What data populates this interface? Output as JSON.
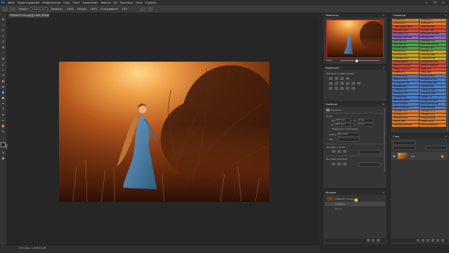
{
  "app": {
    "logo": "Ps",
    "menu": [
      "Файл",
      "Редактирование",
      "Изображение",
      "Слои",
      "Текст",
      "Выделение",
      "Фильтр",
      "3D",
      "Просмотр",
      "Окно",
      "Справка"
    ],
    "window_controls": [
      "—",
      "❐",
      "✕"
    ]
  },
  "options": {
    "items": [
      "Режим:",
      "Нормальный",
      "Непрозр.:",
      "100%",
      "Нажим:",
      "100%",
      "Сглаживание:",
      "10%"
    ]
  },
  "document": {
    "tab_label": "*FRENCH2 v01.jpg @ 100% (RGB/8) ×",
    "status": "100%   Док: 3,52M/3,52M"
  },
  "navigator": {
    "title": "Навигатор",
    "zoom": "100%"
  },
  "adjustments": {
    "title": "Коррекция",
    "subtitle": "Добавить корректировку"
  },
  "properties": {
    "title": "Свойства",
    "doc_label": "Документ",
    "section_canvas": "Холст",
    "w_label": "Ш",
    "h_label": "В",
    "w_value": "3000 пикс.",
    "h_value": "2000 пикс.",
    "x_label": "X",
    "y_label": "Y",
    "x_value": "0 пикс.",
    "y_value": "0 пикс.",
    "resolution": "Разрешение: 72 пикс/дюйм",
    "mode_label": "Режим",
    "mode_value": "Цвета RGB",
    "fill_label": "Фон",
    "section_guides": "Линейки и сетка",
    "section_quick": "Быстрые действия"
  },
  "history": {
    "title": "История",
    "items": [
      "FRENCH2 v01.jpg",
      "Открыть",
      "Кисть"
    ]
  },
  "actions": {
    "title": "Операции",
    "rows": [
      [
        "КОНТРАСТ 1",
        "КОНТРАСТ 2",
        "#e07a2a",
        "#e07a2a"
      ],
      [
        "КОНТРАСТ 3",
        "КОНТРАСТ 4",
        "#e07a2a",
        "#e07a2a"
      ],
      [
        "С ВИГНЕТКОЙ ЯРКО",
        "С ВИГНЕТКОЙ",
        "#d24a3a",
        "#d24a3a"
      ],
      [
        "ТЁПЛЫЙ ЗАКАТ",
        "ТЁПЛЫЙ СВЕТ",
        "#d24a3a",
        "#d24a3a"
      ],
      [
        "ВЕЧЕРНИЙ ТОН",
        "ВЕЧЕРНИЙ МЯГКИЙ",
        "#9c5bbf",
        "#9c5bbf"
      ],
      [
        "МЯГКИЙ КОНТРАСТ",
        "МЯГКИЙ ТОН",
        "#9c5bbf",
        "#9c5bbf"
      ],
      [
        "ЗЕЛЁНЫЙ ЛЕС",
        "ЗЕЛЁНЫЙ ТОН",
        "#4fa04a",
        "#4fa04a"
      ],
      [
        "ЗЕЛЁНЫЙ ЛУГ",
        "ЗЕЛЁНЫЙ МЯГКИЙ",
        "#4fa04a",
        "#4fa04a"
      ],
      [
        "ЛЕТНИЙ ДЕНЬ",
        "ЛЕТНИЙ СВЕТ",
        "#4fa04a",
        "#4fa04a"
      ],
      [
        "ТЁПЛЫЙ ЛЕС",
        "ТЁПЛЫЙ ЛУГ",
        "#c9a227",
        "#c9a227"
      ],
      [
        "ЗОЛОТОЙ ЧАС",
        "ЗОЛОТОЙ СВЕТ",
        "#c9a227",
        "#c9a227"
      ],
      [
        "ОСЕННИЙ ЛИСТ",
        "ОСЕННИЙ ТОН",
        "#c9a227",
        "#c9a227"
      ],
      [
        "ТЁПЛЫЙ ВЕЧЕР",
        "ТЁПЛЫЙ МЯГКИЙ",
        "#d24a3a",
        "#d24a3a"
      ],
      [
        "ВИНТАЖ ТЁПЛЫЙ",
        "ВИНТАЖ МЯГКИЙ",
        "#d24a3a",
        "#d24a3a"
      ],
      [
        "ЯРКИЙ КОНТРАСТ",
        "ЯРКИЙ ТОН",
        "#d24a3a",
        "#d24a3a"
      ],
      [
        "КОНТРАСТ 5",
        "ТЕНИ СВЕТ",
        "#e07a2a",
        "#e07a2a"
      ],
      [
        "НЕЙТРАЛЬНЫЙ",
        "ЧЁРНО-БЕЛЫЙ",
        "#4a7cc9",
        "#4a7cc9"
      ],
      [
        "НЕЙТРАЛ ТЁПЛ",
        "НЕЙТРАЛ ХОЛОД",
        "#4a7cc9",
        "#4a7cc9"
      ],
      [
        "ХОЛОДНЫЙ ТОН",
        "ХОЛОДНЫЙ СВЕТ",
        "#4a7cc9",
        "#4a7cc9"
      ],
      [
        "ЗИМНИЙ ДЕНЬ",
        "ЗИМНИЙ ТОН",
        "#4a7cc9",
        "#4a7cc9"
      ],
      [
        "ГОЛУБОЙ ЧАС",
        "ГОЛУБОЙ СВЕТ",
        "#4a7cc9",
        "#4a7cc9"
      ],
      [
        "МОРСКОЙ ТОН",
        "МОРСКОЙ СВЕТ",
        "#4a7cc9",
        "#4a7cc9"
      ],
      [
        "СИНИЙ ВЕЧЕР",
        "СИНИЙ ТОН",
        "#4a7cc9",
        "#4a7cc9"
      ],
      [
        "МЯГКИЙ СИНИЙ",
        "ХОЛОД КОНТРАСТ",
        "#4a7cc9",
        "#4a7cc9"
      ],
      [
        "КИНО ТЁПЛЫЙ",
        "КИНО ХОЛОДНЫЙ",
        "#4a7cc9",
        "#4a7cc9"
      ],
      [
        "КИНО КОНТРАСТ",
        "КИНО МЯГКИЙ",
        "#4a7cc9",
        "#4a7cc9"
      ],
      [
        "ТЁПЛЫЙ ТОН 1",
        "ТЁПЛЫЙ ТОН 2",
        "#e07a2a",
        "#e07a2a"
      ],
      [
        "ТЁПЛЫЙ ТОН 3",
        "ТЁПЛЫЙ ТОН 4",
        "#e07a2a",
        "#e07a2a"
      ],
      [
        "ЛЕТНИЙ ЗАКАТ",
        "ЛЕТНИЙ ВЕЧЕР",
        "#e07a2a",
        "#e07a2a"
      ],
      [
        "ЯРКИЙ СВЕТ",
        "ЯРКИЙ ЗАКАТ",
        "#e07a2a",
        "#e07a2a"
      ],
      [
        "ТЁПЛЫЙ КОНТРАСТ",
        "ТЁПЛЫЙ ВИНТАЖ",
        "#e07a2a",
        "#e07a2a"
      ]
    ]
  },
  "layers": {
    "title": "Слои",
    "layer_name": "Фон"
  }
}
